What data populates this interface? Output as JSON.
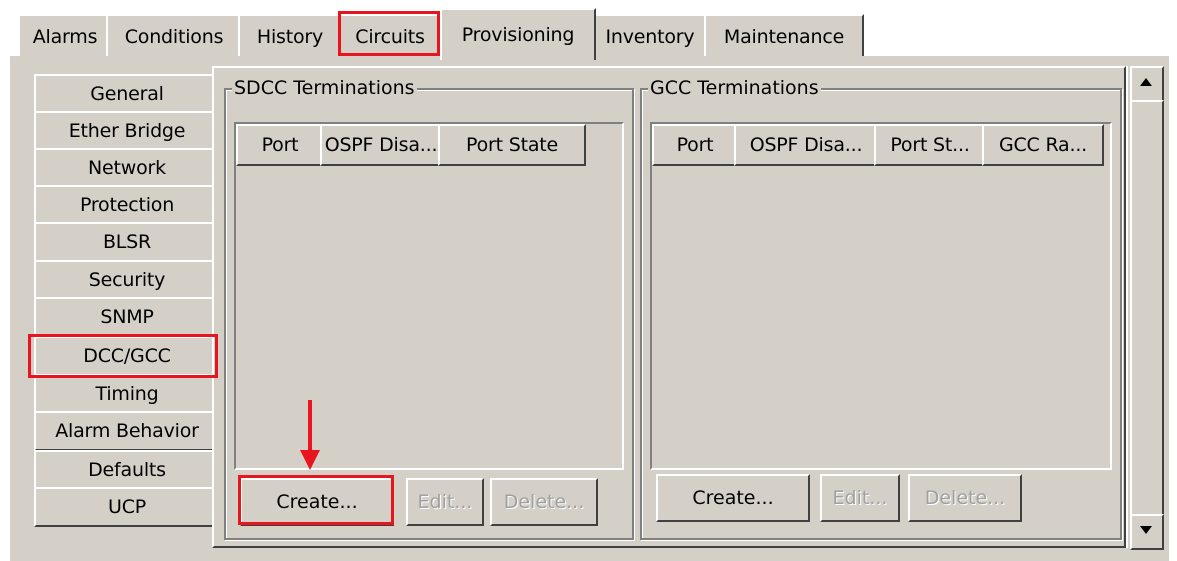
{
  "tabs": [
    {
      "label": "Alarms"
    },
    {
      "label": "Conditions"
    },
    {
      "label": "History"
    },
    {
      "label": "Circuits"
    },
    {
      "label": "Provisioning"
    },
    {
      "label": "Inventory"
    },
    {
      "label": "Maintenance"
    }
  ],
  "active_tab": "Provisioning",
  "subtabs": [
    {
      "label": "General"
    },
    {
      "label": "Ether Bridge"
    },
    {
      "label": "Network"
    },
    {
      "label": "Protection"
    },
    {
      "label": "BLSR"
    },
    {
      "label": "Security"
    },
    {
      "label": "SNMP"
    },
    {
      "label": "DCC/GCC"
    },
    {
      "label": "Timing"
    },
    {
      "label": "Alarm Behavior"
    },
    {
      "label": "Defaults"
    },
    {
      "label": "UCP"
    }
  ],
  "active_subtab": "DCC/GCC",
  "sdcc": {
    "title": "SDCC Terminations",
    "columns": [
      "Port",
      "OSPF Disa...",
      "Port State"
    ],
    "buttons": {
      "create": "Create...",
      "edit": "Edit...",
      "delete": "Delete..."
    }
  },
  "gcc": {
    "title": "GCC Terminations",
    "columns": [
      "Port",
      "OSPF Disa...",
      "Port St...",
      "GCC Ra..."
    ],
    "buttons": {
      "create": "Create...",
      "edit": "Edit...",
      "delete": "Delete..."
    }
  },
  "colors": {
    "panel": "#d4d0c8",
    "highlight": "#e8141e"
  },
  "icons": {
    "scroll_up": "triangle-up-icon",
    "scroll_down": "triangle-down-icon",
    "annotation": "red-down-arrow-icon"
  }
}
